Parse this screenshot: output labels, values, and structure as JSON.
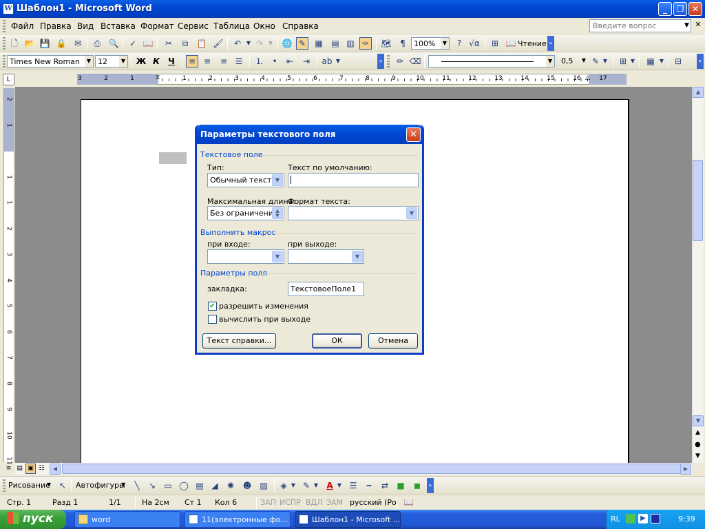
{
  "window": {
    "title": "Шаблон1 - Microsoft Word"
  },
  "menu": {
    "items": [
      "Файл",
      "Правка",
      "Вид",
      "Вставка",
      "Формат",
      "Сервис",
      "Таблица",
      "Окно",
      "Справка"
    ],
    "ask_placeholder": "Введите вопрос"
  },
  "standard_toolbar": {
    "zoom": "100%",
    "reading_label": "Чтение"
  },
  "format_toolbar": {
    "font": "Times New Roman",
    "size": "12",
    "bold": "Ж",
    "italic": "К",
    "underline": "Ч",
    "line_width": "0,5"
  },
  "ruler": {
    "h_labels": [
      "3",
      "2",
      "1",
      "1",
      "2",
      "3",
      "4",
      "5",
      "6",
      "7",
      "8",
      "9",
      "10",
      "11",
      "12",
      "13",
      "14",
      "15",
      "16",
      "17"
    ],
    "v_labels": [
      "2",
      "1",
      "1",
      "1",
      "2",
      "3",
      "4",
      "5",
      "6",
      "7",
      "8",
      "9",
      "10",
      "11"
    ]
  },
  "dialog": {
    "title": "Параметры текстового поля",
    "group_text_field": "Текстовое поле",
    "type_label": "Тип:",
    "type_value": "Обычный текст",
    "default_text_label": "Текст по умолчанию:",
    "default_text_value": "",
    "max_length_label": "Максимальная длина:",
    "max_length_value": "Без ограничений",
    "text_format_label": "Формат текста:",
    "text_format_value": "",
    "group_macro": "Выполнить макрос",
    "on_entry_label": "при входе:",
    "on_exit_label": "при выходе:",
    "group_field_options": "Параметры поля",
    "bookmark_label": "закладка:",
    "bookmark_value": "ТекстовоеПоле1",
    "fill_in_enabled_label": "разрешить изменения",
    "fill_in_enabled_checked": true,
    "calculate_on_exit_label": "вычислить при выходе",
    "calculate_on_exit_checked": false,
    "help_text_button": "Текст справки...",
    "ok_button": "ОК",
    "cancel_button": "Отмена"
  },
  "drawing_toolbar": {
    "drawing_label": "Рисование",
    "autoshapes_label": "Автофигуры"
  },
  "status": {
    "page": "Стр. 1",
    "section": "Разд 1",
    "pages": "1/1",
    "at": "На 2см",
    "line": "Ст 1",
    "col": "Кол 6",
    "rec": "ЗАП",
    "trk": "ИСПР",
    "ext": "ВДЛ",
    "ovr": "ЗАМ",
    "language": "русский (Ро"
  },
  "taskbar": {
    "start": "пуск",
    "tasks": [
      "word",
      "11(электронные фо...",
      "Шаблон1 - Microsoft ..."
    ],
    "lang": "RL",
    "clock": "9:39"
  }
}
